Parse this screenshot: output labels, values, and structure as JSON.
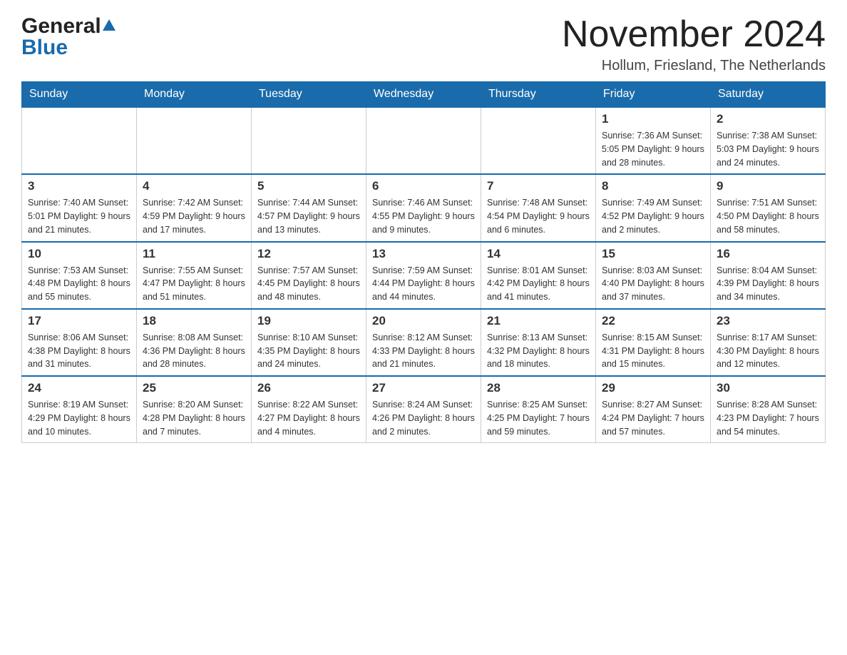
{
  "header": {
    "logo_general": "General",
    "logo_blue": "Blue",
    "month_title": "November 2024",
    "location": "Hollum, Friesland, The Netherlands"
  },
  "days_of_week": [
    "Sunday",
    "Monday",
    "Tuesday",
    "Wednesday",
    "Thursday",
    "Friday",
    "Saturday"
  ],
  "weeks": [
    [
      {
        "day": "",
        "info": ""
      },
      {
        "day": "",
        "info": ""
      },
      {
        "day": "",
        "info": ""
      },
      {
        "day": "",
        "info": ""
      },
      {
        "day": "",
        "info": ""
      },
      {
        "day": "1",
        "info": "Sunrise: 7:36 AM\nSunset: 5:05 PM\nDaylight: 9 hours and 28 minutes."
      },
      {
        "day": "2",
        "info": "Sunrise: 7:38 AM\nSunset: 5:03 PM\nDaylight: 9 hours and 24 minutes."
      }
    ],
    [
      {
        "day": "3",
        "info": "Sunrise: 7:40 AM\nSunset: 5:01 PM\nDaylight: 9 hours and 21 minutes."
      },
      {
        "day": "4",
        "info": "Sunrise: 7:42 AM\nSunset: 4:59 PM\nDaylight: 9 hours and 17 minutes."
      },
      {
        "day": "5",
        "info": "Sunrise: 7:44 AM\nSunset: 4:57 PM\nDaylight: 9 hours and 13 minutes."
      },
      {
        "day": "6",
        "info": "Sunrise: 7:46 AM\nSunset: 4:55 PM\nDaylight: 9 hours and 9 minutes."
      },
      {
        "day": "7",
        "info": "Sunrise: 7:48 AM\nSunset: 4:54 PM\nDaylight: 9 hours and 6 minutes."
      },
      {
        "day": "8",
        "info": "Sunrise: 7:49 AM\nSunset: 4:52 PM\nDaylight: 9 hours and 2 minutes."
      },
      {
        "day": "9",
        "info": "Sunrise: 7:51 AM\nSunset: 4:50 PM\nDaylight: 8 hours and 58 minutes."
      }
    ],
    [
      {
        "day": "10",
        "info": "Sunrise: 7:53 AM\nSunset: 4:48 PM\nDaylight: 8 hours and 55 minutes."
      },
      {
        "day": "11",
        "info": "Sunrise: 7:55 AM\nSunset: 4:47 PM\nDaylight: 8 hours and 51 minutes."
      },
      {
        "day": "12",
        "info": "Sunrise: 7:57 AM\nSunset: 4:45 PM\nDaylight: 8 hours and 48 minutes."
      },
      {
        "day": "13",
        "info": "Sunrise: 7:59 AM\nSunset: 4:44 PM\nDaylight: 8 hours and 44 minutes."
      },
      {
        "day": "14",
        "info": "Sunrise: 8:01 AM\nSunset: 4:42 PM\nDaylight: 8 hours and 41 minutes."
      },
      {
        "day": "15",
        "info": "Sunrise: 8:03 AM\nSunset: 4:40 PM\nDaylight: 8 hours and 37 minutes."
      },
      {
        "day": "16",
        "info": "Sunrise: 8:04 AM\nSunset: 4:39 PM\nDaylight: 8 hours and 34 minutes."
      }
    ],
    [
      {
        "day": "17",
        "info": "Sunrise: 8:06 AM\nSunset: 4:38 PM\nDaylight: 8 hours and 31 minutes."
      },
      {
        "day": "18",
        "info": "Sunrise: 8:08 AM\nSunset: 4:36 PM\nDaylight: 8 hours and 28 minutes."
      },
      {
        "day": "19",
        "info": "Sunrise: 8:10 AM\nSunset: 4:35 PM\nDaylight: 8 hours and 24 minutes."
      },
      {
        "day": "20",
        "info": "Sunrise: 8:12 AM\nSunset: 4:33 PM\nDaylight: 8 hours and 21 minutes."
      },
      {
        "day": "21",
        "info": "Sunrise: 8:13 AM\nSunset: 4:32 PM\nDaylight: 8 hours and 18 minutes."
      },
      {
        "day": "22",
        "info": "Sunrise: 8:15 AM\nSunset: 4:31 PM\nDaylight: 8 hours and 15 minutes."
      },
      {
        "day": "23",
        "info": "Sunrise: 8:17 AM\nSunset: 4:30 PM\nDaylight: 8 hours and 12 minutes."
      }
    ],
    [
      {
        "day": "24",
        "info": "Sunrise: 8:19 AM\nSunset: 4:29 PM\nDaylight: 8 hours and 10 minutes."
      },
      {
        "day": "25",
        "info": "Sunrise: 8:20 AM\nSunset: 4:28 PM\nDaylight: 8 hours and 7 minutes."
      },
      {
        "day": "26",
        "info": "Sunrise: 8:22 AM\nSunset: 4:27 PM\nDaylight: 8 hours and 4 minutes."
      },
      {
        "day": "27",
        "info": "Sunrise: 8:24 AM\nSunset: 4:26 PM\nDaylight: 8 hours and 2 minutes."
      },
      {
        "day": "28",
        "info": "Sunrise: 8:25 AM\nSunset: 4:25 PM\nDaylight: 7 hours and 59 minutes."
      },
      {
        "day": "29",
        "info": "Sunrise: 8:27 AM\nSunset: 4:24 PM\nDaylight: 7 hours and 57 minutes."
      },
      {
        "day": "30",
        "info": "Sunrise: 8:28 AM\nSunset: 4:23 PM\nDaylight: 7 hours and 54 minutes."
      }
    ]
  ]
}
